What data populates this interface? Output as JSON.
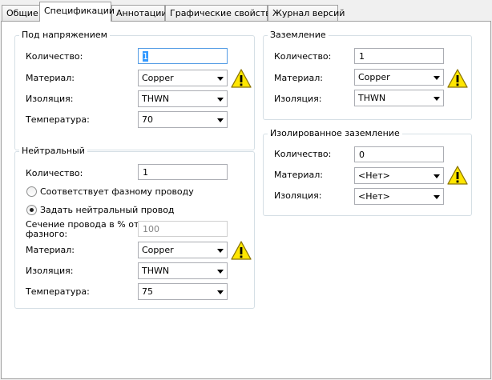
{
  "tabs": [
    {
      "label": "Общие"
    },
    {
      "label": "Спецификации",
      "active": true
    },
    {
      "label": "Аннотации"
    },
    {
      "label": "Графические свойства"
    },
    {
      "label": "Журнал версий"
    }
  ],
  "under_voltage": {
    "title": "Под напряжением",
    "quantity_label": "Количество:",
    "quantity_value": "1",
    "material_label": "Материал:",
    "material_value": "Copper",
    "insulation_label": "Изоляция:",
    "insulation_value": "THWN",
    "temperature_label": "Температура:",
    "temperature_value": "70"
  },
  "neutral": {
    "title": "Нейтральный",
    "quantity_label": "Количество:",
    "quantity_value": "1",
    "radio_match_label": "Соответствует фазному проводу",
    "radio_match_selected": false,
    "radio_set_label": "Задать нейтральный провод",
    "radio_set_selected": true,
    "section_label_line1": "Сечение провода в % от",
    "section_label_line2": "фазного:",
    "section_value": "100",
    "material_label": "Материал:",
    "material_value": "Copper",
    "insulation_label": "Изоляция:",
    "insulation_value": "THWN",
    "temperature_label": "Температура:",
    "temperature_value": "75"
  },
  "ground": {
    "title": "Заземление",
    "quantity_label": "Количество:",
    "quantity_value": "1",
    "material_label": "Материал:",
    "material_value": "Copper",
    "insulation_label": "Изоляция:",
    "insulation_value": "THWN"
  },
  "isolated_ground": {
    "title": "Изолированное заземление",
    "quantity_label": "Количество:",
    "quantity_value": "0",
    "material_label": "Материал:",
    "material_value": "<Нет>",
    "insulation_label": "Изоляция:",
    "insulation_value": "<Нет>"
  },
  "icons": {
    "warning": "warning-icon",
    "dropdown": "chevron-down-icon"
  },
  "colors": {
    "warning_fill": "#ffe600",
    "warning_stroke": "#8a7400",
    "selection": "#3399ff"
  }
}
